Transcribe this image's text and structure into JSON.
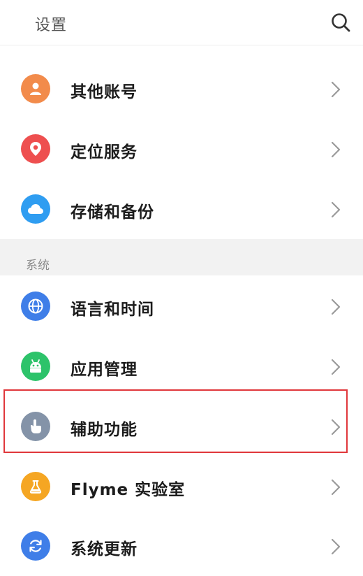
{
  "header": {
    "title": "设置",
    "search_icon": "search-icon"
  },
  "top_items": [
    {
      "label": "其他账号",
      "icon": "person-icon",
      "color": "#f28b4b"
    },
    {
      "label": "定位服务",
      "icon": "location-pin-icon",
      "color": "#ee4f4f"
    },
    {
      "label": "存储和备份",
      "icon": "cloud-icon",
      "color": "#2f9df1"
    }
  ],
  "section": {
    "title": "系统"
  },
  "system_items": [
    {
      "label": "语言和时间",
      "icon": "globe-icon",
      "color": "#3f7ee8"
    },
    {
      "label": "应用管理",
      "icon": "android-icon",
      "color": "#2dc36a"
    },
    {
      "label": "辅助功能",
      "icon": "hand-pointer-icon",
      "color": "#8493a8"
    },
    {
      "label": "Flyme 实验室",
      "icon": "flask-icon",
      "color": "#f5a623"
    },
    {
      "label": "系统更新",
      "icon": "refresh-icon",
      "color": "#3f7ee8"
    }
  ],
  "highlight": {
    "target": "辅助功能",
    "color": "#e0373b"
  }
}
